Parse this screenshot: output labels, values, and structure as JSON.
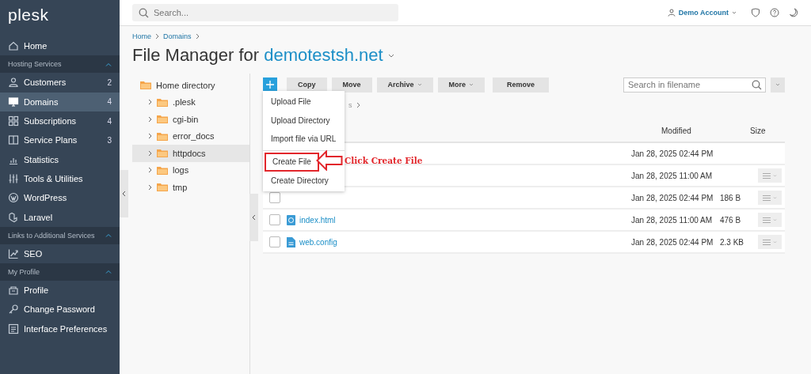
{
  "logo": "plesk",
  "sidebar": [
    {
      "kind": "item",
      "label": "Home",
      "selected": false
    },
    {
      "kind": "section",
      "label": "Hosting Services",
      "expanded": true
    },
    {
      "kind": "item",
      "label": "Customers",
      "count": "2",
      "selected": false
    },
    {
      "kind": "item",
      "label": "Domains",
      "count": "4",
      "selected": true
    },
    {
      "kind": "item",
      "label": "Subscriptions",
      "count": "4",
      "selected": false
    },
    {
      "kind": "item",
      "label": "Service Plans",
      "count": "3",
      "selected": false
    },
    {
      "kind": "item",
      "label": "Statistics",
      "selected": false
    },
    {
      "kind": "item",
      "label": "Tools & Utilities",
      "selected": false
    },
    {
      "kind": "item",
      "label": "WordPress",
      "selected": false
    },
    {
      "kind": "item",
      "label": "Laravel",
      "selected": false
    },
    {
      "kind": "section",
      "label": "Links to Additional Services",
      "expanded": true
    },
    {
      "kind": "item",
      "label": "SEO",
      "selected": false
    },
    {
      "kind": "section",
      "label": "My Profile",
      "expanded": true
    },
    {
      "kind": "item",
      "label": "Profile",
      "selected": false
    },
    {
      "kind": "item",
      "label": "Change Password",
      "selected": false
    },
    {
      "kind": "item",
      "label": "Interface Preferences",
      "selected": false
    }
  ],
  "topbar": {
    "search_placeholder": "Search...",
    "account": "Demo Account"
  },
  "breadcrumb": [
    "Home",
    "Domains"
  ],
  "title": {
    "text": "File Manager for",
    "domain": "demotestsh.net"
  },
  "tree": {
    "label": "Home directory",
    "children": [
      {
        "label": ".plesk",
        "selected": false
      },
      {
        "label": "cgi-bin",
        "selected": false
      },
      {
        "label": "error_docs",
        "selected": false
      },
      {
        "label": "httpdocs",
        "selected": true
      },
      {
        "label": "logs",
        "selected": false
      },
      {
        "label": "tmp",
        "selected": false
      }
    ]
  },
  "toolbar": {
    "buttons": [
      {
        "label": "Copy",
        "dropdown": false
      },
      {
        "label": "Move",
        "dropdown": false
      },
      {
        "label": "Archive",
        "dropdown": true
      },
      {
        "label": "More",
        "dropdown": true
      },
      {
        "label": "Remove",
        "dropdown": false
      }
    ],
    "search_placeholder": "Search in filename"
  },
  "path_fragment": "s",
  "table": {
    "columns": [
      "Modified",
      "Size"
    ],
    "rows": [
      {
        "modified": "Jan 28, 2025 02:44 PM",
        "actions": false
      },
      {
        "modified": "Jan 28, 2025 11:00 AM",
        "actions": true
      },
      {
        "modified": "Jan 28, 2025 02:44 PM",
        "size": "186 B",
        "checked": false,
        "actions": true
      },
      {
        "name": "index.html",
        "modified": "Jan 28, 2025 11:00 AM",
        "size": "476 B",
        "checked": false,
        "actions": true,
        "kind": "web"
      },
      {
        "name": "web.config",
        "modified": "Jan 28, 2025 02:44 PM",
        "size": "2.3 KB",
        "checked": false,
        "actions": true,
        "kind": "doc"
      }
    ]
  },
  "add_menu": {
    "items": [
      {
        "label": "Upload File",
        "highlighted": false
      },
      {
        "label": "Upload Directory",
        "highlighted": false
      },
      {
        "label": "Import file via URL",
        "highlighted": false
      },
      {
        "label": "Create File",
        "highlighted": true
      },
      {
        "label": "Create Directory",
        "highlighted": false
      }
    ]
  },
  "annotation": "Click Create File"
}
